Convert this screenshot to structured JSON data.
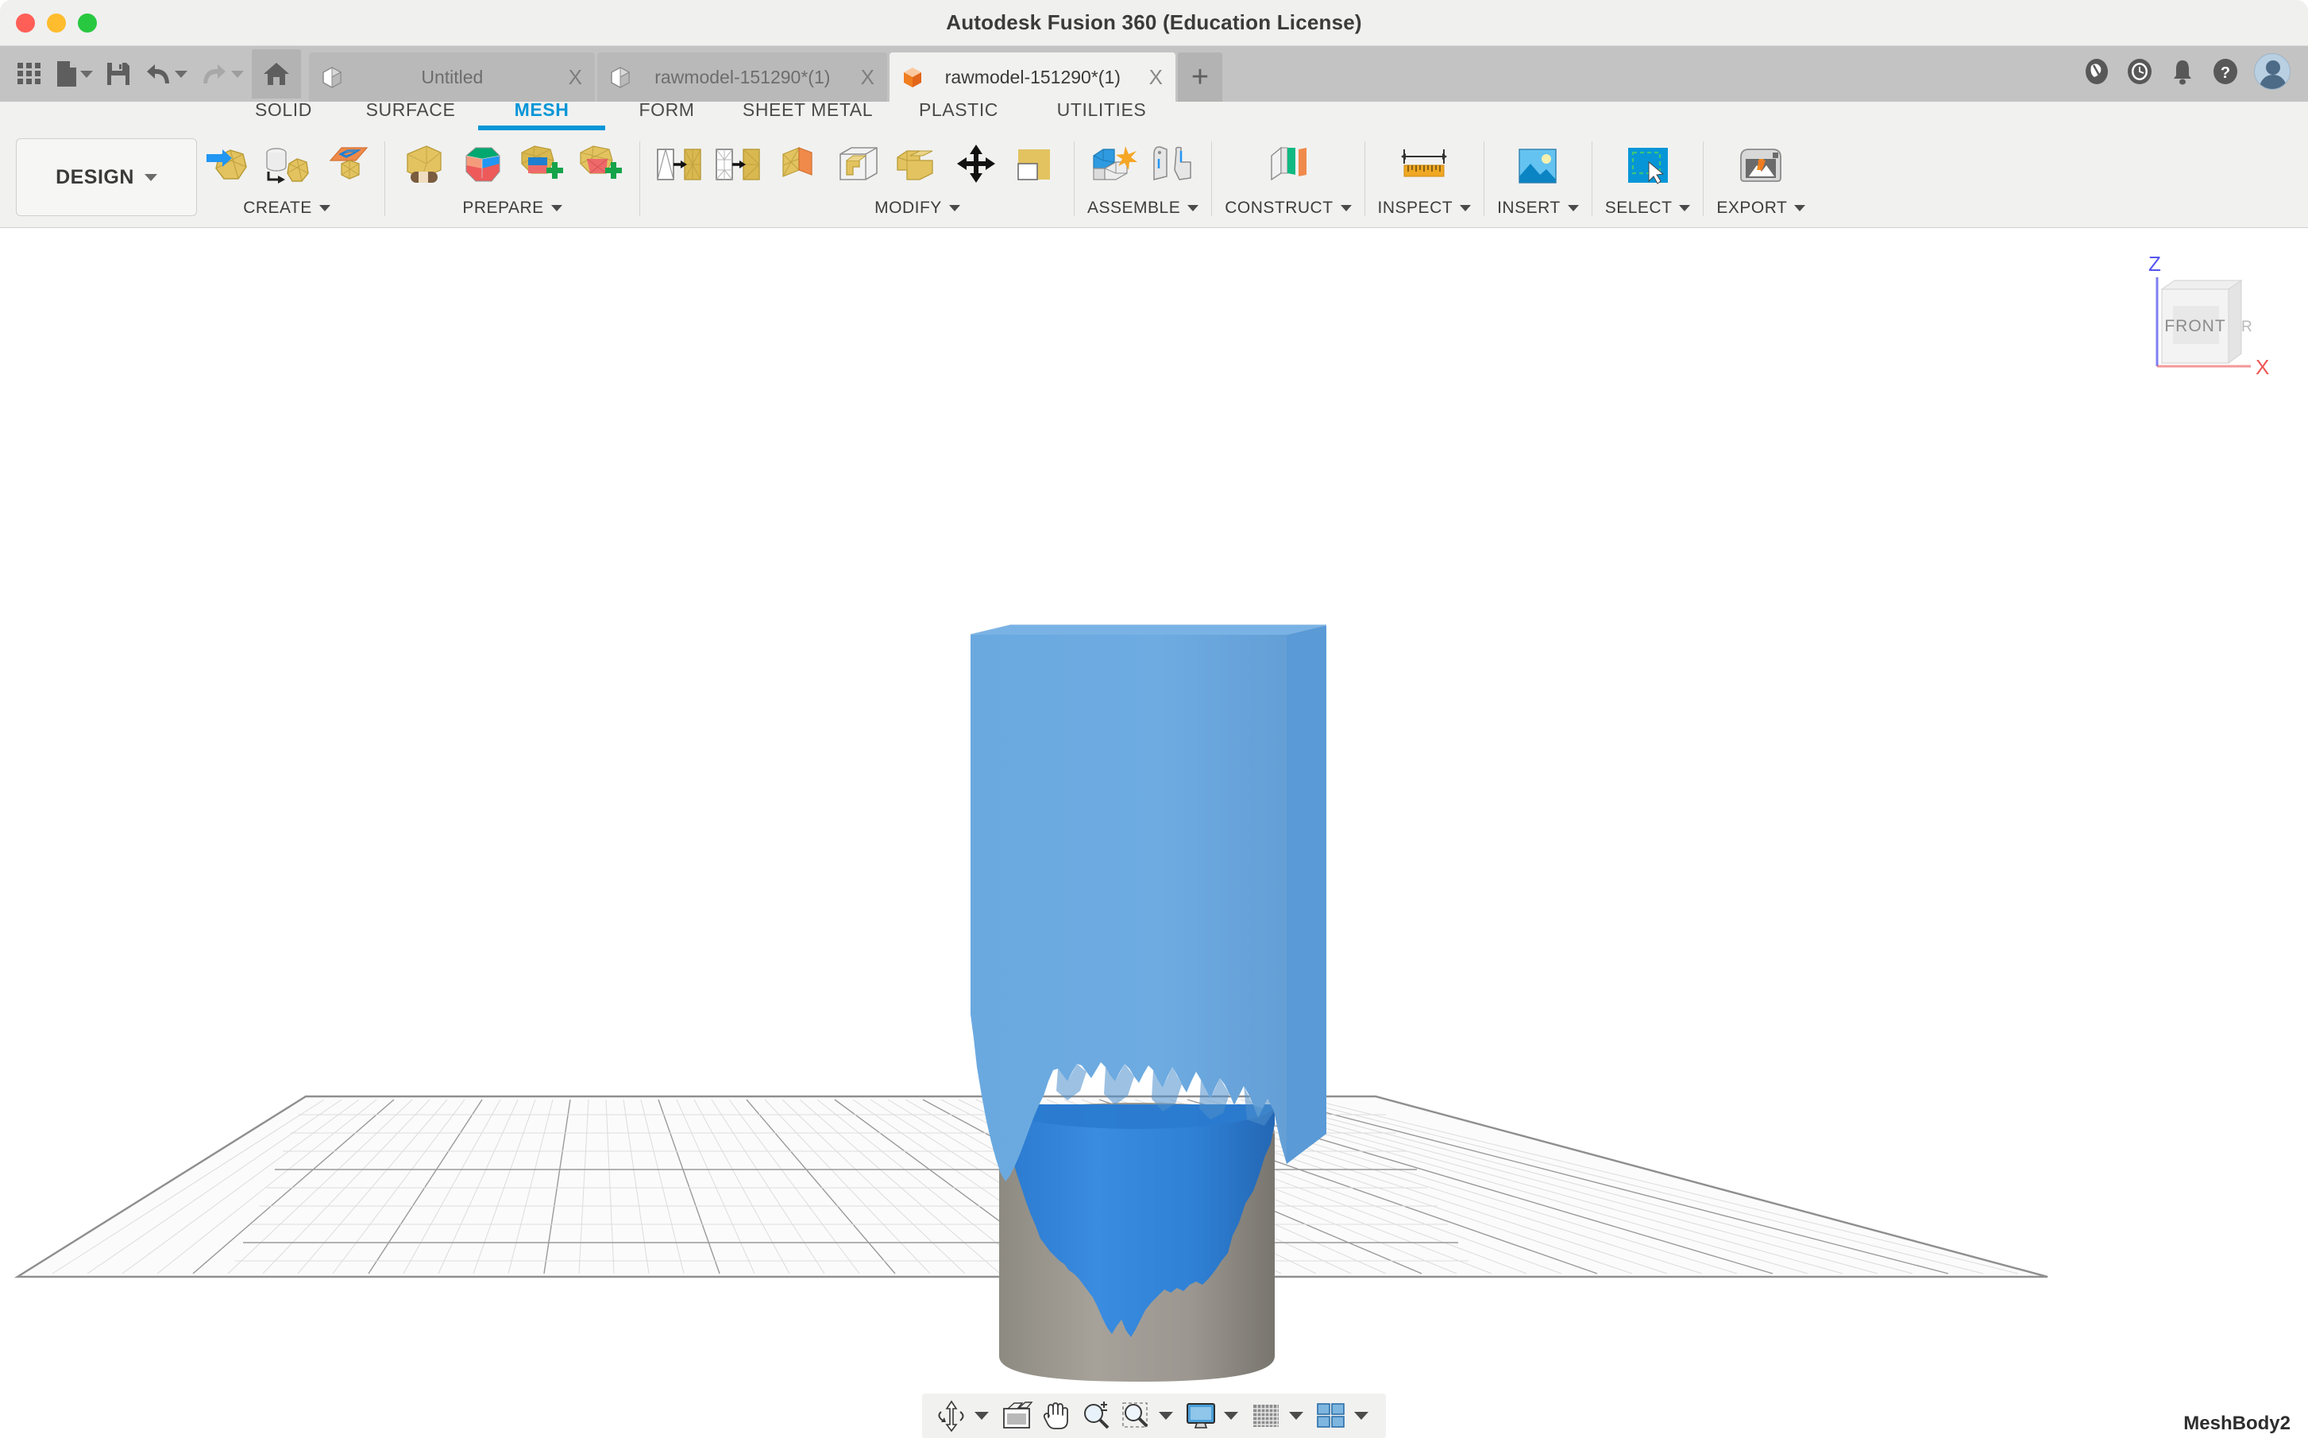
{
  "window": {
    "title": "Autodesk Fusion 360 (Education License)",
    "traffic_lights": [
      "close-button",
      "minimize-button",
      "maximize-button"
    ]
  },
  "quick_access": {
    "items": [
      {
        "name": "app-grid-icon",
        "label": "Show Data Panel"
      },
      {
        "name": "file-icon",
        "label": "File",
        "has_caret": true
      },
      {
        "name": "save-icon",
        "label": "Save"
      },
      {
        "name": "undo-icon",
        "label": "Undo",
        "has_caret": true
      },
      {
        "name": "redo-icon",
        "label": "Redo",
        "has_caret": true
      },
      {
        "name": "home-icon",
        "label": "Home"
      }
    ]
  },
  "tabs": [
    {
      "label": "Untitled",
      "icon": "grey-cube-icon",
      "active": false,
      "close": "X"
    },
    {
      "label": "rawmodel-151290*(1)",
      "icon": "grey-cube-icon",
      "active": false,
      "close": "X"
    },
    {
      "label": "rawmodel-151290*(1)",
      "icon": "orange-cube-icon",
      "active": true,
      "close": "X"
    }
  ],
  "tab_add": {
    "label": "+",
    "name": "new-tab-button"
  },
  "header_icons": [
    {
      "name": "job-status-icon",
      "label": "Job Status"
    },
    {
      "name": "extensions-icon",
      "label": "Extensions"
    },
    {
      "name": "notifications-bell-icon",
      "label": "Notifications"
    },
    {
      "name": "help-icon",
      "label": "Help"
    },
    {
      "name": "account-avatar",
      "label": "Account"
    }
  ],
  "workspace": {
    "label": "DESIGN",
    "has_caret": true
  },
  "ribbon_tabs": [
    {
      "label": "SOLID",
      "active": false
    },
    {
      "label": "SURFACE",
      "active": false
    },
    {
      "label": "MESH",
      "active": true
    },
    {
      "label": "FORM",
      "active": false
    },
    {
      "label": "SHEET METAL",
      "active": false
    },
    {
      "label": "PLASTIC",
      "active": false
    },
    {
      "label": "UTILITIES",
      "active": false
    }
  ],
  "ribbon_panels": [
    {
      "label": "CREATE",
      "has_caret": true,
      "tools": [
        {
          "name": "create-mesh-icon",
          "label": "Create Mesh"
        },
        {
          "name": "brep-to-mesh-icon",
          "label": "BRep to Mesh"
        },
        {
          "name": "mesh-section-sketch-icon",
          "label": "Mesh Section Sketch"
        }
      ]
    },
    {
      "label": "PREPARE",
      "has_caret": true,
      "tools": [
        {
          "name": "repair-mesh-icon",
          "label": "Repair"
        },
        {
          "name": "segment-mesh-icon",
          "label": "Segment"
        },
        {
          "name": "generate-face-groups-icon",
          "label": "Generate Face Groups"
        },
        {
          "name": "create-face-group-icon",
          "label": "Create Face Group"
        },
        {
          "name": "reduce-mesh-icon",
          "label": "Reduce"
        },
        {
          "name": "remesh-icon",
          "label": "Remesh"
        }
      ]
    },
    {
      "label": "MODIFY",
      "has_caret": true,
      "tools": [
        {
          "name": "plane-cut-icon",
          "label": "Plane Cut"
        },
        {
          "name": "separate-mesh-icon",
          "label": "Separate"
        },
        {
          "name": "merge-bodies-icon",
          "label": "Merge Bodies"
        },
        {
          "name": "move-copy-icon",
          "label": "Move/Copy"
        },
        {
          "name": "delete-icon",
          "label": "Delete"
        }
      ]
    },
    {
      "label": "ASSEMBLE",
      "has_caret": true,
      "tools": [
        {
          "name": "new-component-icon",
          "label": "New Component"
        },
        {
          "name": "joint-icon",
          "label": "Joint"
        }
      ]
    },
    {
      "label": "CONSTRUCT",
      "has_caret": true,
      "tools": [
        {
          "name": "offset-plane-icon",
          "label": "Offset Plane"
        }
      ]
    },
    {
      "label": "INSPECT",
      "has_caret": true,
      "tools": [
        {
          "name": "measure-icon",
          "label": "Measure"
        }
      ]
    },
    {
      "label": "INSERT",
      "has_caret": true,
      "tools": [
        {
          "name": "insert-canvas-icon",
          "label": "Canvas"
        }
      ]
    },
    {
      "label": "SELECT",
      "has_caret": true,
      "tools": [
        {
          "name": "select-window-icon",
          "label": "Select"
        }
      ]
    },
    {
      "label": "EXPORT",
      "has_caret": true,
      "tools": [
        {
          "name": "3d-print-icon",
          "label": "3D Print"
        }
      ]
    }
  ],
  "viewcube": {
    "face_label": "FRONT",
    "axis_z": "Z",
    "axis_x": "X",
    "axis_z_color": "#5555ee",
    "axis_x_color": "#ee5555"
  },
  "viewport": {
    "browser_label": "MeshBody2",
    "model": {
      "box_front_color": "#6aa9e0",
      "box_side_color": "#5a9ad6",
      "box_top_color": "#79b2e4",
      "cylinder_blue_color": "#2f80d8",
      "cylinder_grey_color": "#9a968c"
    },
    "grid": {
      "major_line_color": "#9a9a9a",
      "minor_line_color": "#dcdcdc",
      "x_axis_color": "#f07a7a",
      "y_axis_color": "#4fd24f"
    }
  },
  "nav_bar": [
    {
      "name": "orbit-icon",
      "label": "Orbit",
      "has_caret": true
    },
    {
      "name": "look-at-icon",
      "label": "Look At",
      "has_caret": false
    },
    {
      "name": "pan-icon",
      "label": "Pan",
      "has_caret": false
    },
    {
      "name": "zoom-icon",
      "label": "Zoom",
      "has_caret": false
    },
    {
      "name": "zoom-window-icon",
      "label": "Fit",
      "has_caret": true
    },
    {
      "name": "display-settings-icon",
      "label": "Display Settings",
      "has_caret": true
    },
    {
      "name": "grid-snaps-icon",
      "label": "Grid and Snaps",
      "has_caret": true
    },
    {
      "name": "viewports-icon",
      "label": "Viewports",
      "has_caret": true
    }
  ]
}
